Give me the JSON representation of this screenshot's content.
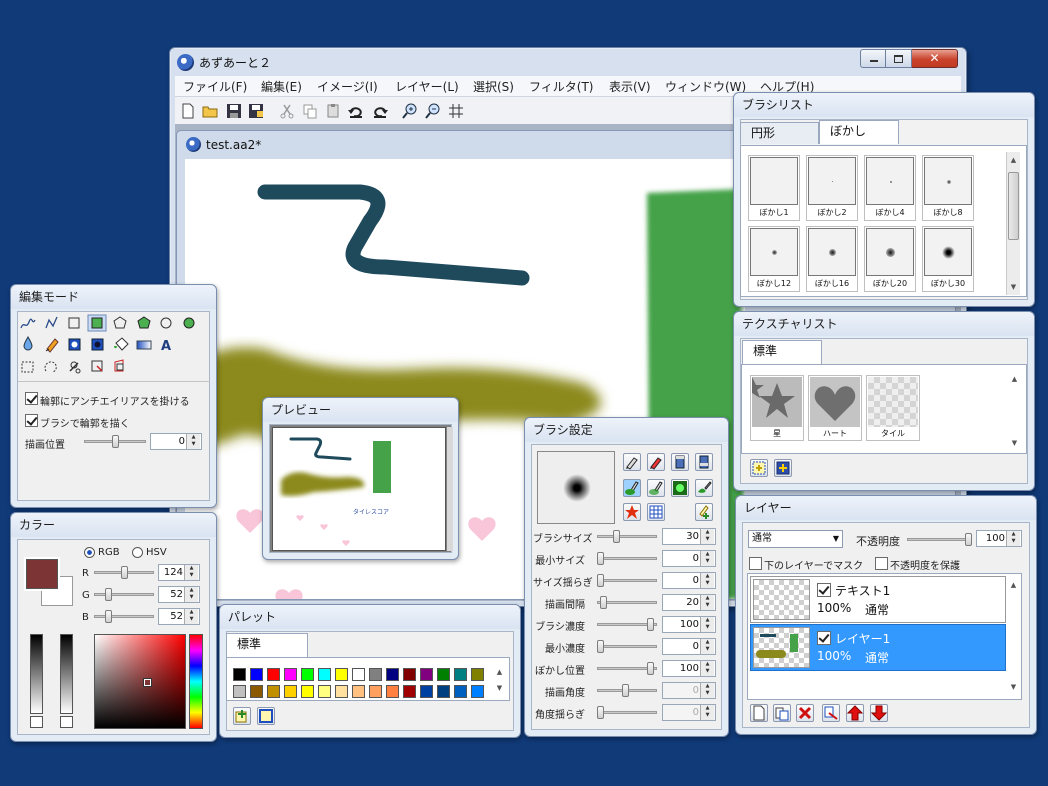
{
  "app": {
    "title": "あずあーと２",
    "menus": [
      "ファイル(F)",
      "編集(E)",
      "イメージ(I)",
      "レイヤー(L)",
      "選択(S)",
      "フィルタ(T)",
      "表示(V)",
      "ウィンドウ(W)",
      "ヘルプ(H)"
    ],
    "document_title": "test.aa2*"
  },
  "edit_mode": {
    "title": "編集モード",
    "antialias_label": "輪郭にアンチエイリアスを掛ける",
    "antialias_checked": true,
    "brush_outline_label": "ブラシで輪郭を描く",
    "brush_outline_checked": true,
    "draw_position_label": "描画位置",
    "draw_position_value": "0",
    "text_tool_glyph": "A"
  },
  "color": {
    "title": "カラー",
    "mode_rgb": "RGB",
    "mode_hsv": "HSV",
    "r_label": "R",
    "r_value": "124",
    "g_label": "G",
    "g_value": "52",
    "b_label": "B",
    "b_value": "52",
    "fg_color": "#7c3434",
    "bg_color": "#ffffff"
  },
  "preview": {
    "title": "プレビュー",
    "caption_text": "タイレスコア"
  },
  "palette": {
    "title": "パレット",
    "tab": "標準",
    "colors": [
      "#000000",
      "#0000ff",
      "#ff0000",
      "#ff00ff",
      "#00ff00",
      "#00ffff",
      "#ffff00",
      "#ffffff",
      "#808080",
      "#000080",
      "#800000",
      "#800080",
      "#008000",
      "#008080",
      "#808000",
      "#c0c0c0",
      "#8b5a00",
      "#c09000",
      "#ffd000",
      "#ffff00",
      "#ffff80",
      "#ffe0a0",
      "#ffc080",
      "#ffa060",
      "#ff8040",
      "#a00000",
      "#0040a0",
      "#004080",
      "#0060c0",
      "#0080ff"
    ]
  },
  "brush_settings": {
    "title": "ブラシ設定",
    "rows": [
      {
        "label": "ブラシサイズ",
        "value": "30",
        "disabled": false
      },
      {
        "label": "最小サイズ",
        "value": "0",
        "disabled": false
      },
      {
        "label": "サイズ揺らぎ",
        "value": "0",
        "disabled": false
      },
      {
        "label": "描画間隔",
        "value": "20",
        "disabled": false
      },
      {
        "label": "ブラシ濃度",
        "value": "100",
        "disabled": false
      },
      {
        "label": "最小濃度",
        "value": "0",
        "disabled": false
      },
      {
        "label": "ぼかし位置",
        "value": "100",
        "disabled": false
      },
      {
        "label": "描画角度",
        "value": "0",
        "disabled": true
      },
      {
        "label": "角度揺らぎ",
        "value": "0",
        "disabled": true
      }
    ]
  },
  "brush_list": {
    "title": "ブラシリスト",
    "tabs": [
      "円形",
      "ぼかし"
    ],
    "active_tab": "ぼかし",
    "items": [
      "ぼかし1",
      "ぼかし2",
      "ぼかし4",
      "ぼかし8",
      "ぼかし12",
      "ぼかし16",
      "ぼかし20",
      "ぼかし30"
    ]
  },
  "texture_list": {
    "title": "テクスチャリスト",
    "tab": "標準",
    "items": [
      "星",
      "ハート",
      "タイル"
    ]
  },
  "layers": {
    "title": "レイヤー",
    "blend_mode": "通常",
    "opacity_label": "不透明度",
    "opacity_value": "100",
    "mask_label": "下のレイヤーでマスク",
    "protect_label": "不透明度を保護",
    "items": [
      {
        "name": "テキスト1",
        "opacity": "100%",
        "mode": "通常",
        "visible": true,
        "selected": false
      },
      {
        "name": "レイヤー1",
        "opacity": "100%",
        "mode": "通常",
        "visible": true,
        "selected": true
      }
    ]
  }
}
